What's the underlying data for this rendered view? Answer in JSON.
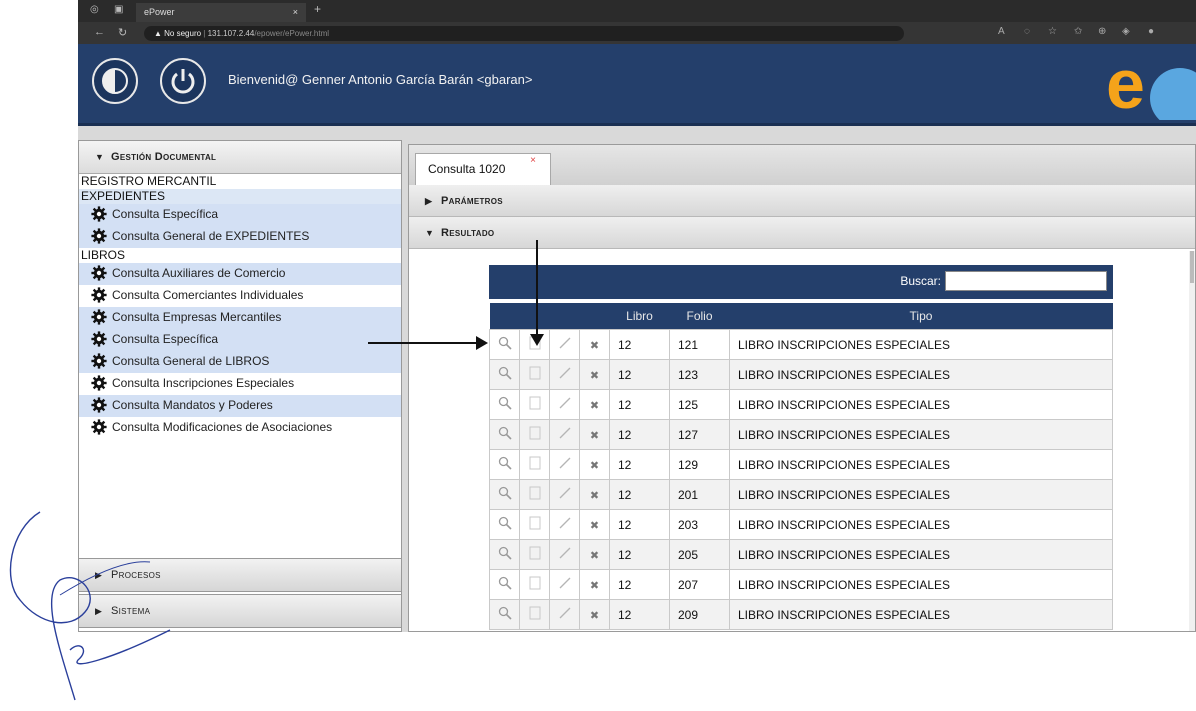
{
  "browser": {
    "tab_title": "ePower",
    "tab_close": "×",
    "new_tab": "+",
    "url_security": "▲ No seguro",
    "url_host": "131.107.2.44",
    "url_path": "/epower/ePower.html"
  },
  "header": {
    "welcome": "Bienvenid@ Genner Antonio García Barán <gbaran>",
    "logo_text": "e"
  },
  "sidebar": {
    "accordion_title": "Gestión Documental",
    "sections": [
      {
        "label": "REGISTRO MERCANTIL",
        "items": []
      },
      {
        "label": "EXPEDIENTES",
        "items": [
          "Consulta Específica",
          "Consulta General de EXPEDIENTES"
        ]
      },
      {
        "label": "LIBROS",
        "items": [
          "Consulta Auxiliares de Comercio",
          "Consulta Comerciantes Individuales",
          "Consulta Empresas Mercantiles",
          "Consulta Específica",
          "Consulta General de LIBROS",
          "Consulta Inscripciones Especiales",
          "Consulta Mandatos y Poderes",
          "Consulta Modificaciones de Asociaciones"
        ]
      }
    ],
    "bottom": [
      "Procesos",
      "Sistema"
    ]
  },
  "main": {
    "tab_label": "Consulta 1020",
    "tab_close": "×",
    "parametros": "Parámetros",
    "resultado": "Resultado",
    "search_label": "Buscar:",
    "columns": [
      "Libro",
      "Folio",
      "Tipo"
    ],
    "rows": [
      {
        "libro": "12",
        "folio": "121",
        "tipo": "LIBRO INSCRIPCIONES ESPECIALES"
      },
      {
        "libro": "12",
        "folio": "123",
        "tipo": "LIBRO INSCRIPCIONES ESPECIALES"
      },
      {
        "libro": "12",
        "folio": "125",
        "tipo": "LIBRO INSCRIPCIONES ESPECIALES"
      },
      {
        "libro": "12",
        "folio": "127",
        "tipo": "LIBRO INSCRIPCIONES ESPECIALES"
      },
      {
        "libro": "12",
        "folio": "129",
        "tipo": "LIBRO INSCRIPCIONES ESPECIALES"
      },
      {
        "libro": "12",
        "folio": "201",
        "tipo": "LIBRO INSCRIPCIONES ESPECIALES"
      },
      {
        "libro": "12",
        "folio": "203",
        "tipo": "LIBRO INSCRIPCIONES ESPECIALES"
      },
      {
        "libro": "12",
        "folio": "205",
        "tipo": "LIBRO INSCRIPCIONES ESPECIALES"
      },
      {
        "libro": "12",
        "folio": "207",
        "tipo": "LIBRO INSCRIPCIONES ESPECIALES"
      },
      {
        "libro": "12",
        "folio": "209",
        "tipo": "LIBRO INSCRIPCIONES ESPECIALES"
      }
    ]
  },
  "colors": {
    "header_bg": "#243f6b",
    "selected_row_bg": "#d3e0f4",
    "logo_orange": "#f5a31a",
    "logo_blue": "#5aa7e0"
  },
  "icons": {
    "row_actions": [
      "magnifier-icon",
      "document-icon",
      "pencil-icon",
      "delete-icon"
    ],
    "menu_item": "gear-icon"
  }
}
